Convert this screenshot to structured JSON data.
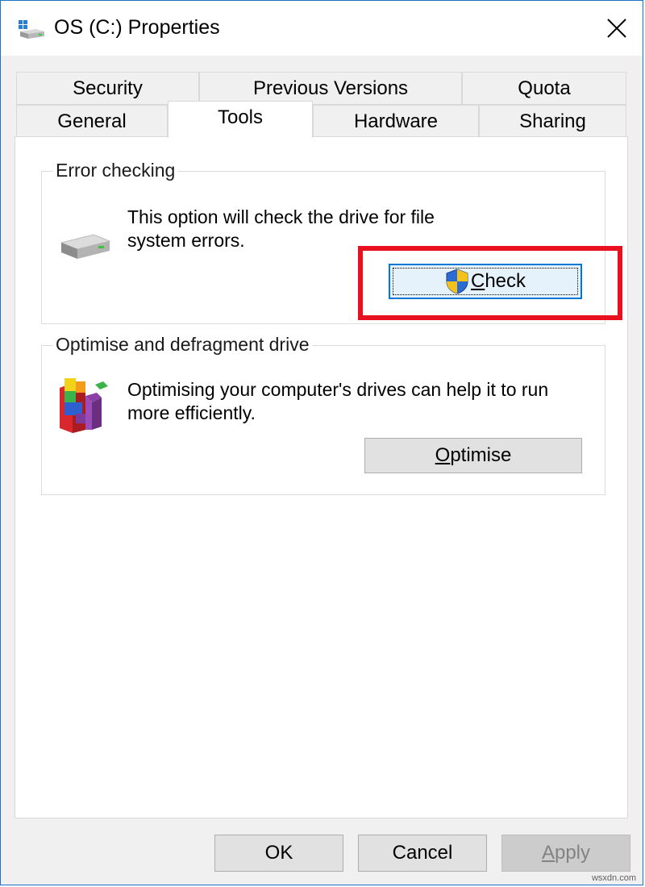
{
  "window": {
    "title": "OS (C:) Properties",
    "close_glyph": "✕"
  },
  "tabs": {
    "row1": [
      {
        "label": "Security"
      },
      {
        "label": "Previous Versions"
      },
      {
        "label": "Quota"
      }
    ],
    "row2": [
      {
        "label": "General"
      },
      {
        "label": "Tools",
        "selected": true
      },
      {
        "label": "Hardware"
      },
      {
        "label": "Sharing"
      }
    ]
  },
  "error_checking": {
    "group_label": "Error checking",
    "description_line1": "This option will check the drive for file",
    "description_line2": "system errors.",
    "check_button": {
      "accesskey": "C",
      "rest": "heck",
      "icon": "uac-shield-icon"
    },
    "drive_icon": "drive-icon"
  },
  "optimise": {
    "group_label": "Optimise and defragment drive",
    "description_line1": "Optimising your computer's drives can help it to run",
    "description_line2": "more efficiently.",
    "optimise_button": {
      "accesskey": "O",
      "rest": "ptimise"
    },
    "defrag_icon": "defrag-icon"
  },
  "footer": {
    "ok_label": "OK",
    "cancel_label": "Cancel",
    "apply_accesskey": "A",
    "apply_rest": "pply"
  },
  "annotation": {
    "highlight_color": "#e8101f"
  },
  "watermark": "wsxdn.com",
  "colors": {
    "accent": "#0078d7",
    "window_border": "#1e6fc8"
  }
}
